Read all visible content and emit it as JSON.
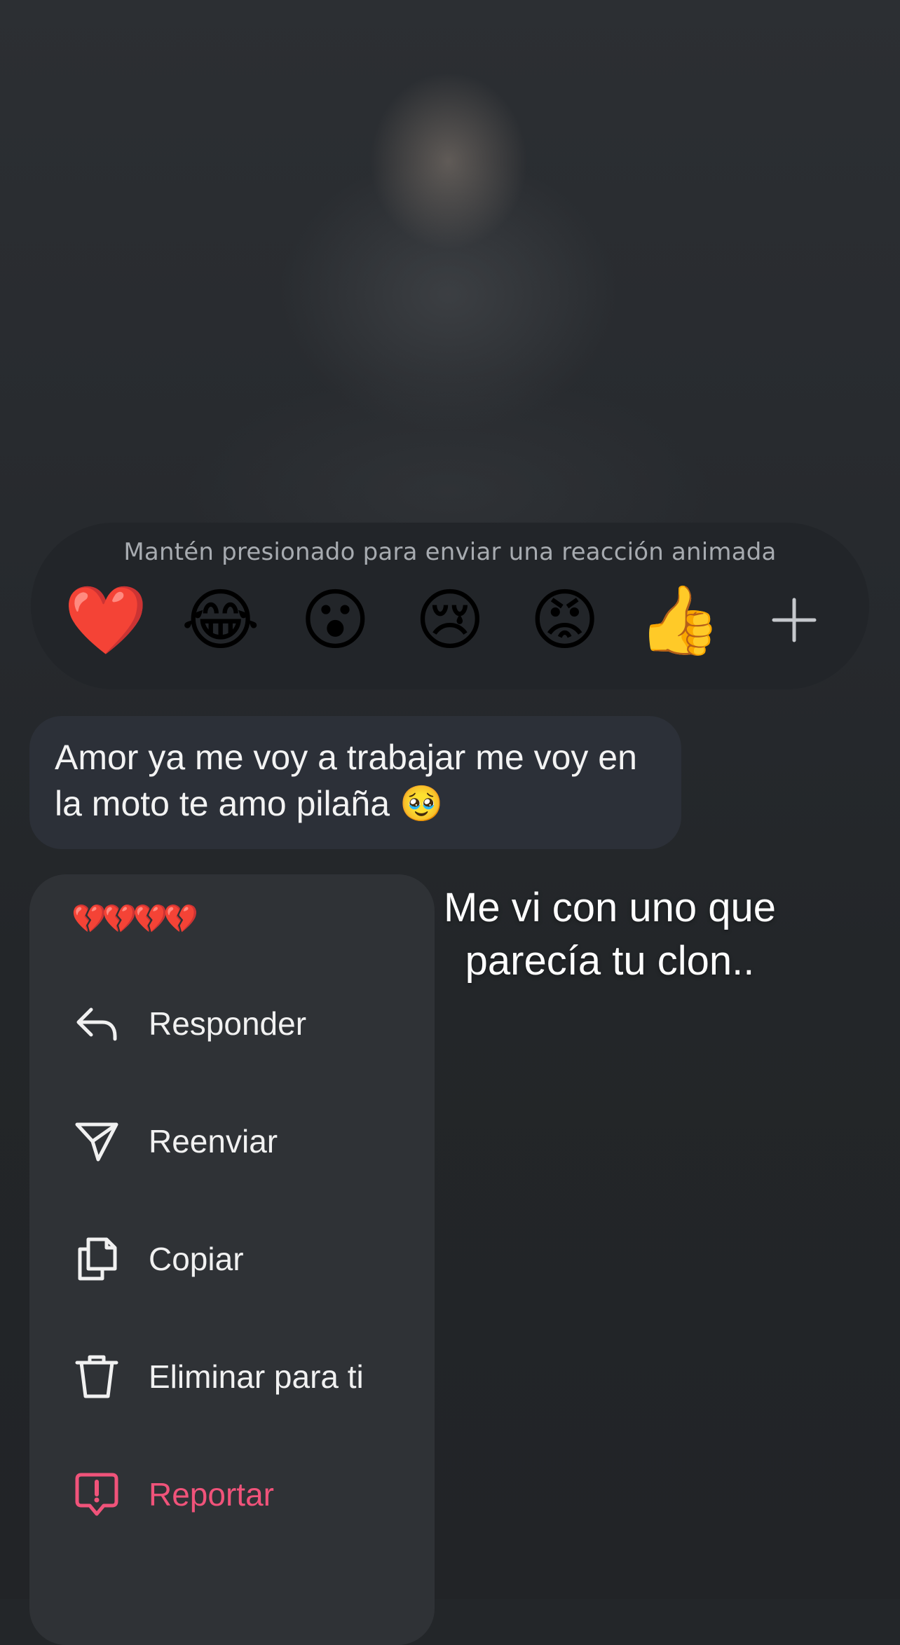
{
  "reaction_bar": {
    "hint": "Mantén presionado para enviar una reacción animada",
    "emojis": [
      "❤️",
      "😂",
      "😮",
      "😢",
      "😡",
      "👍"
    ],
    "add_icon": "plus-icon"
  },
  "message": {
    "text": "Amor ya me voy a trabajar me voy en la moto te amo pilaña 🥹"
  },
  "overlay_caption": "Me vi con uno que parecía tu clon..",
  "context_menu": {
    "header_emojis": "💔💔💔💔",
    "items": [
      {
        "label": "Responder",
        "icon": "reply-icon"
      },
      {
        "label": "Reenviar",
        "icon": "forward-icon"
      },
      {
        "label": "Copiar",
        "icon": "copy-icon"
      },
      {
        "label": "Eliminar para ti",
        "icon": "trash-icon"
      },
      {
        "label": "Reportar",
        "icon": "report-icon"
      }
    ]
  },
  "colors": {
    "danger": "#f0537a",
    "menu_bg": "#2f3236",
    "bubble_bg": "#2c3038"
  }
}
